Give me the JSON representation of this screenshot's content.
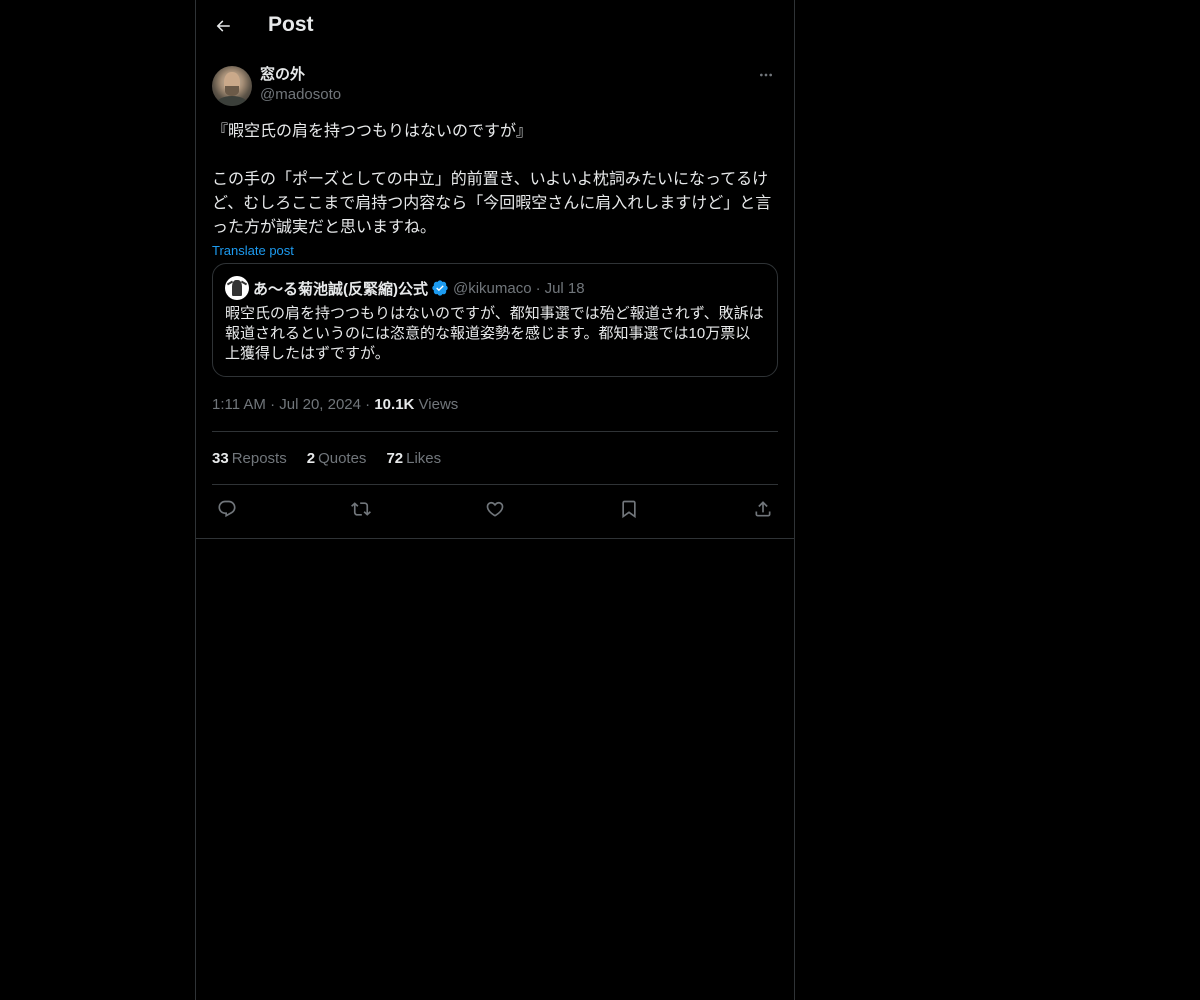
{
  "header": {
    "back_icon": "arrow-left-icon",
    "title": "Post"
  },
  "post": {
    "author": {
      "display_name": "窓の外",
      "handle": "@madosoto"
    },
    "more_icon": "more-horizontal-icon",
    "text": "『暇空氏の肩を持つつもりはないのですが』\n\nこの手の「ポーズとしての中立」的前置き、いよいよ枕詞みたいになってるけど、むしろここまで肩持つ内容なら「今回暇空さんに肩入れしますけど」と言った方が誠実だと思いますね。",
    "translate_label": "Translate post",
    "quote": {
      "display_name": "あ〜る菊池誠(反緊縮)公式",
      "verified_icon": "verified-badge-icon",
      "handle": "@kikumaco",
      "separator": "·",
      "date": "Jul 18",
      "text": "暇空氏の肩を持つつもりはないのですが、都知事選では殆ど報道されず、敗訴は報道されるというのには恣意的な報道姿勢を感じます。都知事選では10万票以上獲得したはずですが。"
    },
    "time": "1:11 AM",
    "separator": "·",
    "date": "Jul 20, 2024",
    "views_count": "10.1K",
    "views_label": "Views",
    "stats": {
      "reposts_count": "33",
      "reposts_label": "Reposts",
      "quotes_count": "2",
      "quotes_label": "Quotes",
      "likes_count": "72",
      "likes_label": "Likes"
    },
    "actions": [
      "reply-icon",
      "repost-icon",
      "like-icon",
      "bookmark-icon",
      "share-icon"
    ]
  },
  "colors": {
    "background": "#000000",
    "text": "#e7e9ea",
    "secondary_text": "#71767b",
    "link": "#1d9bf0",
    "border": "#2f3336",
    "verified": "#1d9bf0"
  }
}
